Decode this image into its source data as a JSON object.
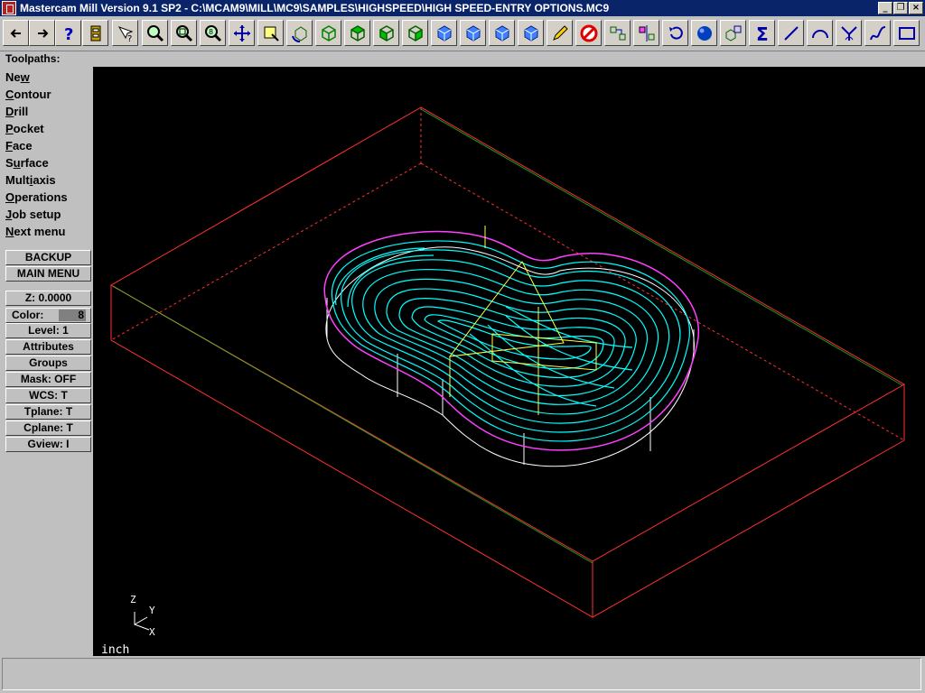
{
  "window": {
    "title": "Mastercam Mill Version 9.1 SP2 - C:\\MCAM9\\MILL\\MC9\\SAMPLES\\HIGHSPEED\\HIGH SPEED-ENTRY OPTIONS.MC9",
    "minimize": "_",
    "maximize": "❐",
    "close": "×"
  },
  "toolbar": {
    "icons": [
      "back-arrow-icon",
      "forward-arrow-icon",
      "help-icon",
      "sheet-icon",
      "cursor-help-icon",
      "zoom-icon",
      "zoom-window-icon",
      "zoom-8-icon",
      "pan-icon",
      "select-icon",
      "rotate-icon",
      "view-iso-icon",
      "view-top-icon",
      "view-front-icon",
      "view-side-icon",
      "view-cube-1-icon",
      "view-cube-2-icon",
      "view-cube-3-icon",
      "view-cube-4-icon",
      "pencil-icon",
      "no-entry-icon",
      "move-icon",
      "mirror-icon",
      "undo-icon",
      "sphere-icon",
      "transform-icon",
      "sum-icon",
      "line-icon",
      "arc-icon",
      "fillet-icon",
      "spline-icon",
      "rectangle-icon"
    ]
  },
  "panel": {
    "header": "Toolpaths:",
    "menu": [
      {
        "pre": "Ne",
        "u": "w",
        "post": ""
      },
      {
        "pre": "",
        "u": "C",
        "post": "ontour"
      },
      {
        "pre": "",
        "u": "D",
        "post": "rill"
      },
      {
        "pre": "",
        "u": "P",
        "post": "ocket"
      },
      {
        "pre": "",
        "u": "F",
        "post": "ace"
      },
      {
        "pre": "S",
        "u": "u",
        "post": "rface"
      },
      {
        "pre": "Mult",
        "u": "i",
        "post": "axis"
      },
      {
        "pre": "",
        "u": "O",
        "post": "perations"
      },
      {
        "pre": "",
        "u": "J",
        "post": "ob setup"
      },
      {
        "pre": "",
        "u": "N",
        "post": "ext menu"
      }
    ],
    "backup": "BACKUP",
    "main_menu": "MAIN MENU",
    "z": "Z:  0.0000",
    "color_label": "Color:",
    "color_value": "8",
    "level": "Level:  1",
    "attributes": "Attributes",
    "groups": "Groups",
    "mask": "Mask:  OFF",
    "wcs": "WCS:   T",
    "tplane": "Tplane:  T",
    "cplane": "Cplane:  T",
    "gview": "Gview:   I"
  },
  "viewport": {
    "units": "inch",
    "axis_z": "Z",
    "axis_y": "Y",
    "axis_x": "X",
    "colors": {
      "background": "#000000",
      "stock": "#ff3030",
      "toolpath": "#00ffff",
      "boundary": "#ff00ff",
      "geometry": "#ffffff",
      "entry": "#ffff00"
    }
  },
  "status": {
    "text": ""
  }
}
